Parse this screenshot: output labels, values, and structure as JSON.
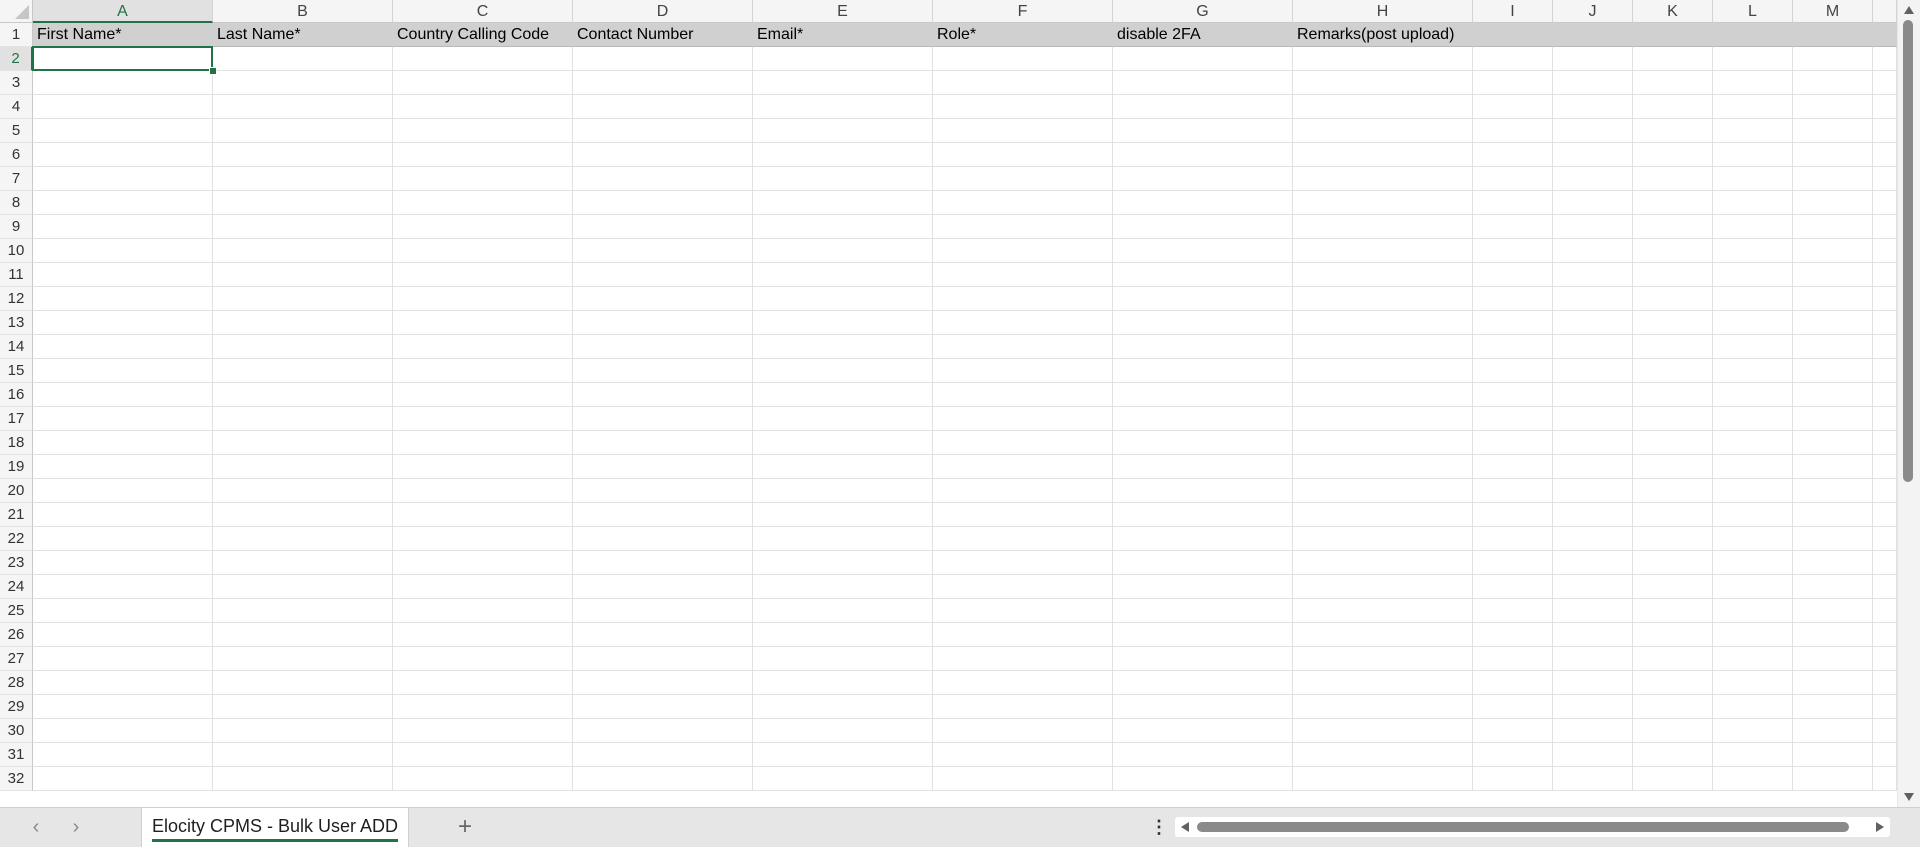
{
  "columns": [
    "A",
    "B",
    "C",
    "D",
    "E",
    "F",
    "G",
    "H",
    "I",
    "J",
    "K",
    "L",
    "M"
  ],
  "header_row": [
    "First Name*",
    "Last Name*",
    "Country Calling Code",
    "Contact Number",
    "Email*",
    "Role*",
    "disable 2FA",
    "Remarks(post upload)",
    "",
    "",
    "",
    "",
    ""
  ],
  "rows": [
    "1",
    "2",
    "3",
    "4",
    "5",
    "6",
    "7",
    "8",
    "9",
    "10",
    "11",
    "12",
    "13",
    "14",
    "15",
    "16",
    "17",
    "18",
    "19",
    "20",
    "21",
    "22",
    "23",
    "24",
    "25",
    "26",
    "27",
    "28",
    "29",
    "30",
    "31",
    "32"
  ],
  "selected_cell": "A2",
  "sheet_tab": {
    "label": "Elocity CPMS - Bulk User ADD"
  },
  "icons": {
    "prev": "chevron-left-icon",
    "next": "chevron-right-icon",
    "add": "plus-icon",
    "more": "more-vertical-icon"
  },
  "colors": {
    "accent": "#217346",
    "header_fill": "#d0d0d0"
  }
}
